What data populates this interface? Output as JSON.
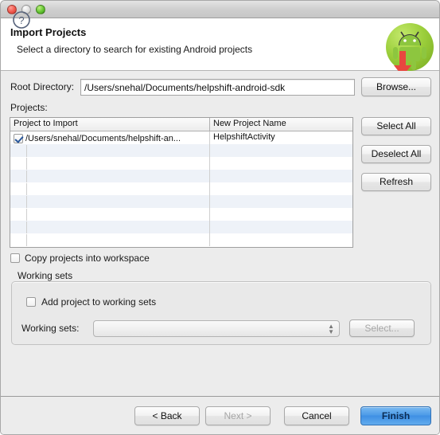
{
  "window": {
    "traffic_lights": [
      "close",
      "minimize",
      "zoom"
    ]
  },
  "header": {
    "title": "Import Projects",
    "subtitle": "Select a directory to search for existing Android projects",
    "badge_icon": "android-robot-icon"
  },
  "annotations": {
    "arrow_icon": "red-down-arrow-annotation",
    "underline_target": "Root Directory:"
  },
  "form": {
    "root_directory_label": "Root Directory:",
    "root_directory_value": "/Users/snehal/Documents/helpshift-android-sdk",
    "root_directory_placeholder": "",
    "browse_label": "Browse...",
    "projects_label": "Projects:"
  },
  "table": {
    "columns": [
      "Project to Import",
      "New Project Name"
    ],
    "rows": [
      {
        "checked": true,
        "project": "/Users/snehal/Documents/helpshift-an...",
        "name": "HelpshiftActivity"
      },
      {
        "checked": null,
        "project": "",
        "name": ""
      },
      {
        "checked": null,
        "project": "",
        "name": ""
      },
      {
        "checked": null,
        "project": "",
        "name": ""
      },
      {
        "checked": null,
        "project": "",
        "name": ""
      },
      {
        "checked": null,
        "project": "",
        "name": ""
      },
      {
        "checked": null,
        "project": "",
        "name": ""
      },
      {
        "checked": null,
        "project": "",
        "name": ""
      },
      {
        "checked": null,
        "project": "",
        "name": ""
      }
    ]
  },
  "side_buttons": {
    "select_all": "Select All",
    "deselect_all": "Deselect All",
    "refresh": "Refresh"
  },
  "options": {
    "copy_projects_label": "Copy projects into workspace",
    "copy_projects_checked": false
  },
  "working_sets": {
    "legend": "Working sets",
    "add_label": "Add project to working sets",
    "add_checked": false,
    "select_label": "Working sets:",
    "select_value": "",
    "select_button": "Select...",
    "select_button_enabled": false
  },
  "footer": {
    "help_icon": "help-question-icon",
    "back": "< Back",
    "next": "Next >",
    "next_enabled": false,
    "cancel": "Cancel",
    "finish": "Finish"
  },
  "colors": {
    "accent_blue": "#3e8fe4",
    "annotation_red": "#e8473f",
    "android_green": "#9ccf3c",
    "row_alt": "#eef2f8",
    "chrome": "#ececec"
  }
}
